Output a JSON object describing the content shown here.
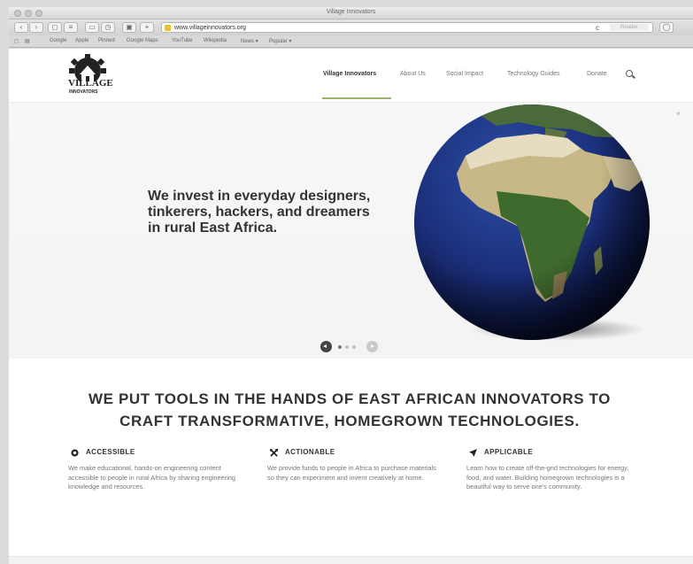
{
  "browser": {
    "window_title": "Village Innovators",
    "url": "www.villageinnovators.org",
    "reader_label": "Reader",
    "bookmarks": [
      "Google",
      "Apple",
      "Pinned",
      "Google Maps",
      "YouTube",
      "Wikipedia",
      "News ▾",
      "Popular ▾"
    ]
  },
  "site": {
    "logo_line1": "VILLAGE",
    "logo_line2": "INNOVATORS",
    "nav": [
      {
        "label": "Village Innovators",
        "active": true
      },
      {
        "label": "About Us",
        "active": false
      },
      {
        "label": "Social Impact",
        "active": false
      },
      {
        "label": "Technology Guides",
        "active": false
      },
      {
        "label": "Donate",
        "active": false
      }
    ],
    "accent_color": "#9bb26a"
  },
  "hero": {
    "close_label": "×",
    "text_line1": "We invest in everyday designers,",
    "text_line2": "tinkerers, hackers, and dreamers",
    "text_line3": "in rural East Africa.",
    "slide_count": 3
  },
  "mission": {
    "line1": "WE PUT TOOLS IN THE HANDS OF EAST AFRICAN INNOVATORS TO",
    "line2": "CRAFT TRANSFORMATIVE, HOMEGROWN TECHNOLOGIES."
  },
  "columns": [
    {
      "icon": "circle-dot-icon",
      "title": "ACCESSIBLE",
      "body": "We make educational, hands-on engineering content accessible to people in rural Africa by sharing engineering knowledge and resources."
    },
    {
      "icon": "tools-icon",
      "title": "ACTIONABLE",
      "body": "We provide funds to people in Africa to purchase materials so they can experiment and invent creatively at home."
    },
    {
      "icon": "send-icon",
      "title": "APPLICABLE",
      "body": "Learn how to create off-the-grid technologies for energy, food, and water. Building homegrown technologies is a beautiful way to serve one's community."
    }
  ]
}
